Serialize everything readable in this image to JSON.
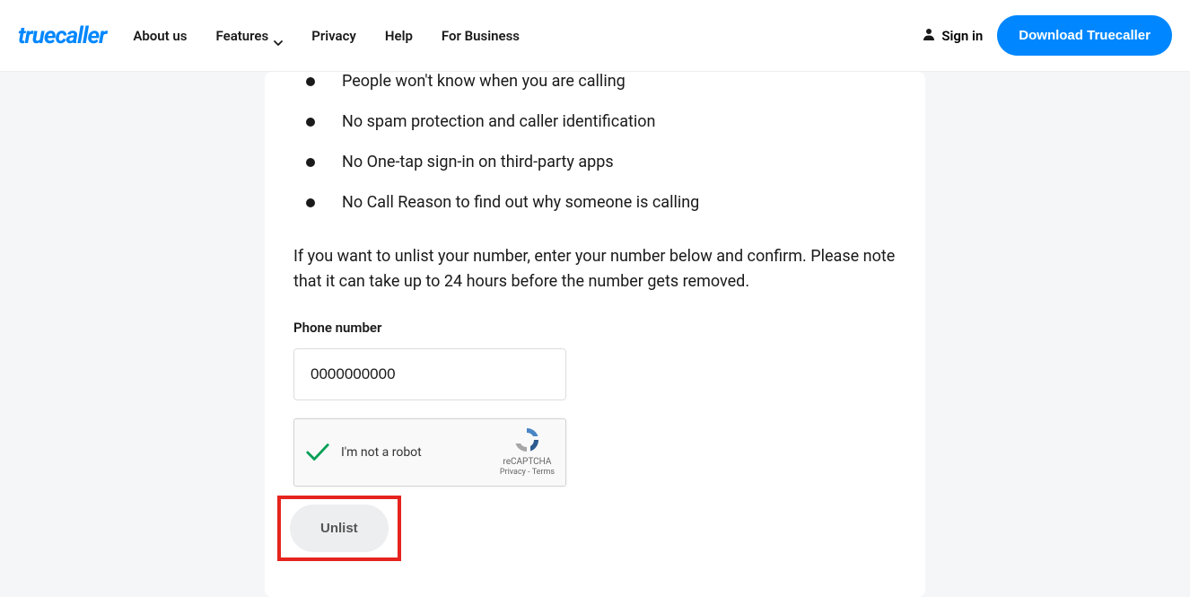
{
  "header": {
    "logo": "truecaller",
    "nav": {
      "about": "About us",
      "features": "Features",
      "privacy": "Privacy",
      "help": "Help",
      "business": "For Business"
    },
    "signin": "Sign in",
    "download": "Download Truecaller"
  },
  "card": {
    "bullets": [
      "People won't know when you are calling",
      "No spam protection and caller identification",
      "No One-tap sign-in on third-party apps",
      "No Call Reason to find out why someone is calling"
    ],
    "paragraph": "If you want to unlist your number, enter your number below and confirm. Please note that it can take up to 24 hours before the number gets removed.",
    "phone_label": "Phone number",
    "phone_value": "0000000000",
    "recaptcha": {
      "label": "I'm not a robot",
      "brand": "reCAPTCHA",
      "terms": "Privacy - Terms"
    },
    "unlist_label": "Unlist"
  }
}
